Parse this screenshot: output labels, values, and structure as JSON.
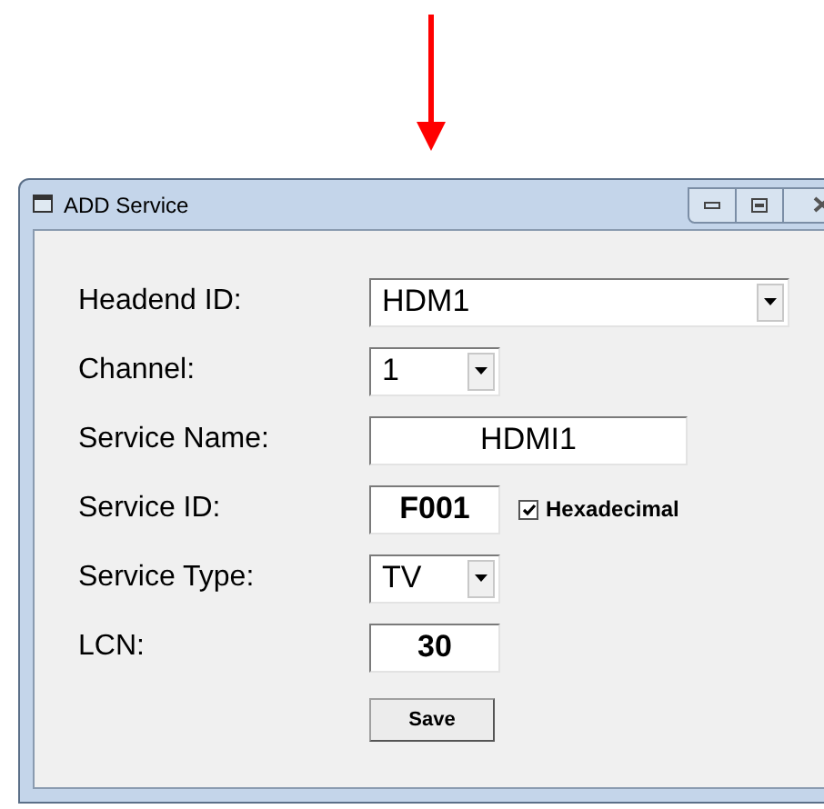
{
  "window": {
    "title": "ADD Service"
  },
  "fields": [
    {
      "label": "Headend ID:",
      "kind": "select",
      "value": "HDM1"
    },
    {
      "label": "Channel:",
      "kind": "select",
      "value": "1"
    },
    {
      "label": "Service Name:",
      "kind": "text",
      "value": "HDMI1"
    },
    {
      "label": "Service ID:",
      "kind": "text",
      "value": "F001",
      "option": {
        "label": "Hexadecimal",
        "checked": true
      }
    },
    {
      "label": "Service Type:",
      "kind": "select",
      "value": "TV"
    },
    {
      "label": "LCN:",
      "kind": "text",
      "value": "30"
    }
  ],
  "buttons": [
    {
      "label": "Save"
    }
  ]
}
